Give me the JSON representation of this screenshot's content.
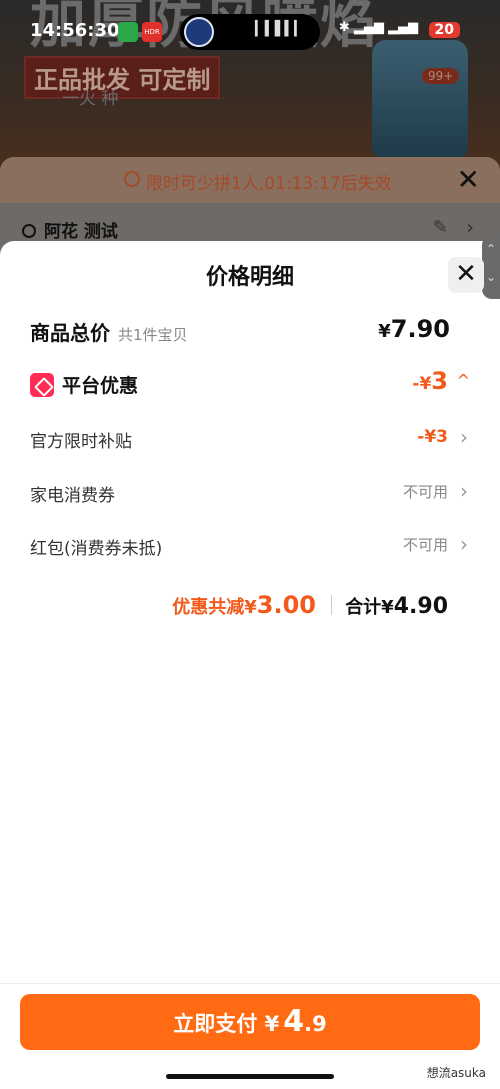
{
  "status_bar": {
    "time": "14:56:30",
    "icons": [
      "app-icon",
      "hdr-icon",
      "bluetooth-icon",
      "5g-signal-icon",
      "5g-signal-icon"
    ],
    "battery": "20"
  },
  "background": {
    "banner_text": "加厚防风喷焰",
    "tag": "正品批发 可定制",
    "sub_text": "一火   种",
    "product_badge": "99+"
  },
  "checkout": {
    "countdown_text": "限时可少拼1人,01:13:17后失效",
    "address": "阿花 测试"
  },
  "modal": {
    "title": "价格明细",
    "total": {
      "label": "商品总价",
      "count": "共1件宝贝",
      "currency": "¥",
      "price": "7.90"
    },
    "platform_discount": {
      "label": "平台优惠",
      "sign": "-¥",
      "amount": "3",
      "caret": "^"
    },
    "items": [
      {
        "label": "官方限时补贴",
        "value": "-¥3"
      },
      {
        "label": "家电消费券",
        "value": "不可用"
      },
      {
        "label": "红包(消费券未抵)",
        "value": "不可用"
      }
    ],
    "summary": {
      "discount_label": "优惠共减¥",
      "discount_amount": "3.00",
      "total_label": "合计¥",
      "total_amount": "4.90"
    },
    "pay_button": {
      "label": "立即支付",
      "currency": "¥",
      "amount": "4",
      "cents": ".9"
    },
    "watermark": "想流asuka"
  },
  "colors": {
    "accent": "#f25a1c",
    "pay_button": "#ff6a13",
    "coupon_icon": "#ff2d55"
  }
}
